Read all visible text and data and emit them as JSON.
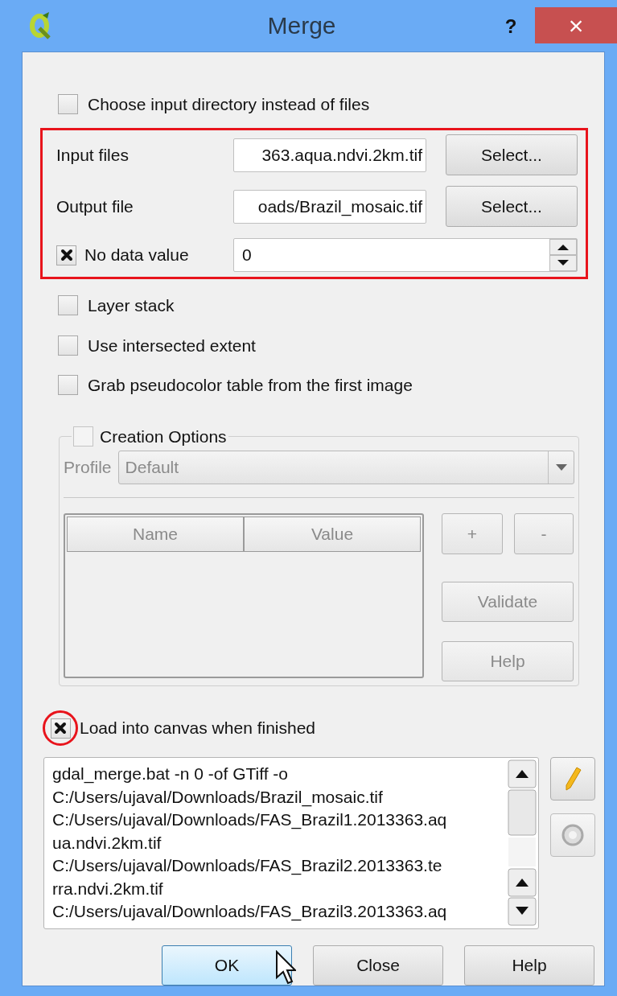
{
  "window": {
    "title": "Merge",
    "help_button": "?",
    "close_button": "×"
  },
  "choose_directory": {
    "label": "Choose input directory instead of files",
    "checked": false
  },
  "files": [
    {
      "label": "Input files",
      "value": "363.aqua.ndvi.2km.tif",
      "button": "Select..."
    },
    {
      "label": "Output file",
      "value": "oads/Brazil_mosaic.tif",
      "button": "Select..."
    }
  ],
  "no_data": {
    "label": "No data value",
    "checked": true,
    "value": "0"
  },
  "options": [
    {
      "label": "Layer stack",
      "checked": false
    },
    {
      "label": "Use intersected extent",
      "checked": false
    },
    {
      "label": "Grab pseudocolor table from the first image",
      "checked": false
    }
  ],
  "creation_options": {
    "label": "Creation Options",
    "checked": false,
    "disabled": true,
    "profile_label": "Profile",
    "profile": "Default",
    "table": {
      "columns": [
        "Name",
        "Value"
      ]
    },
    "buttons": [
      "+",
      "-",
      "Validate",
      "Help"
    ]
  },
  "load_into_canvas": {
    "label": "Load into canvas when finished",
    "checked": true
  },
  "command": [
    "gdal_merge.bat -n 0 -of GTiff -o",
    "C:/Users/ujaval/Downloads/Brazil_mosaic.tif",
    "C:/Users/ujaval/Downloads/FAS_Brazil1.2013363.aq",
    "ua.ndvi.2km.tif",
    "C:/Users/ujaval/Downloads/FAS_Brazil2.2013363.te",
    "rra.ndvi.2km.tif",
    "C:/Users/ujaval/Downloads/FAS_Brazil3.2013363.aq"
  ],
  "buttons": [
    {
      "label": "OK",
      "default": true
    },
    {
      "label": "Close",
      "default": false
    },
    {
      "label": "Help",
      "default": false
    }
  ]
}
